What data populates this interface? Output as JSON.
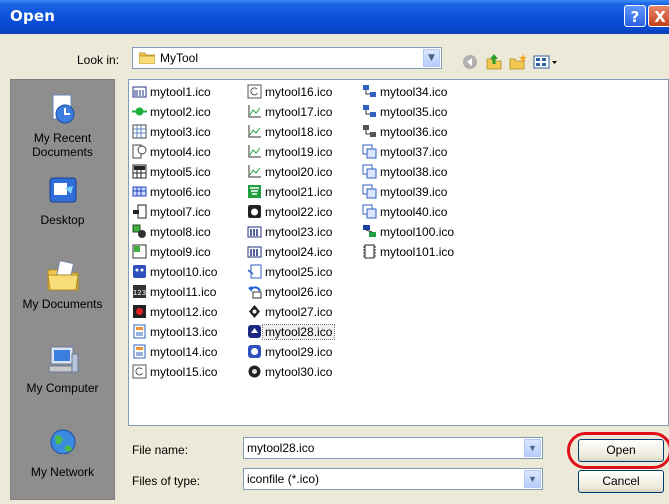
{
  "window": {
    "title": "Open",
    "help_label": "?",
    "close_label": "X"
  },
  "lookin": {
    "label": "Look in:",
    "value": "MyTool"
  },
  "places": [
    {
      "label_line1": "My Recent",
      "label_line2": "Documents",
      "icon": "recent-documents-icon"
    },
    {
      "label_line1": "Desktop",
      "label_line2": "",
      "icon": "desktop-icon"
    },
    {
      "label_line1": "My Documents",
      "label_line2": "",
      "icon": "my-documents-icon"
    },
    {
      "label_line1": "My Computer",
      "label_line2": "",
      "icon": "my-computer-icon"
    },
    {
      "label_line1": "My Network",
      "label_line2": "",
      "icon": "my-network-icon"
    }
  ],
  "files": {
    "column1": [
      "mytool1.ico",
      "mytool2.ico",
      "mytool3.ico",
      "mytool4.ico",
      "mytool5.ico",
      "mytool6.ico",
      "mytool7.ico",
      "mytool8.ico",
      "mytool9.ico",
      "mytool10.ico",
      "mytool11.ico",
      "mytool12.ico",
      "mytool13.ico",
      "mytool14.ico",
      "mytool15.ico"
    ],
    "column2": [
      "mytool16.ico",
      "mytool17.ico",
      "mytool18.ico",
      "mytool19.ico",
      "mytool20.ico",
      "mytool21.ico",
      "mytool22.ico",
      "mytool23.ico",
      "mytool24.ico",
      "mytool25.ico",
      "mytool26.ico",
      "mytool27.ico",
      "mytool28.ico",
      "mytool29.ico",
      "mytool30.ico"
    ],
    "column3": [
      "mytool34.ico",
      "mytool35.ico",
      "mytool36.ico",
      "mytool37.ico",
      "mytool38.ico",
      "mytool39.ico",
      "mytool40.ico",
      "mytool100.ico",
      "mytool101.ico"
    ],
    "selected": "mytool28.ico"
  },
  "filename": {
    "label": "File name:",
    "value": "mytool28.ico"
  },
  "filetype": {
    "label": "Files of type:",
    "value": "iconfile (*.ico)"
  },
  "buttons": {
    "open": "Open",
    "cancel": "Cancel"
  },
  "colors": {
    "titlebar": "#0a4fd8",
    "highlight_circle": "#e0101a",
    "dialog_bg": "#ece9d8"
  }
}
